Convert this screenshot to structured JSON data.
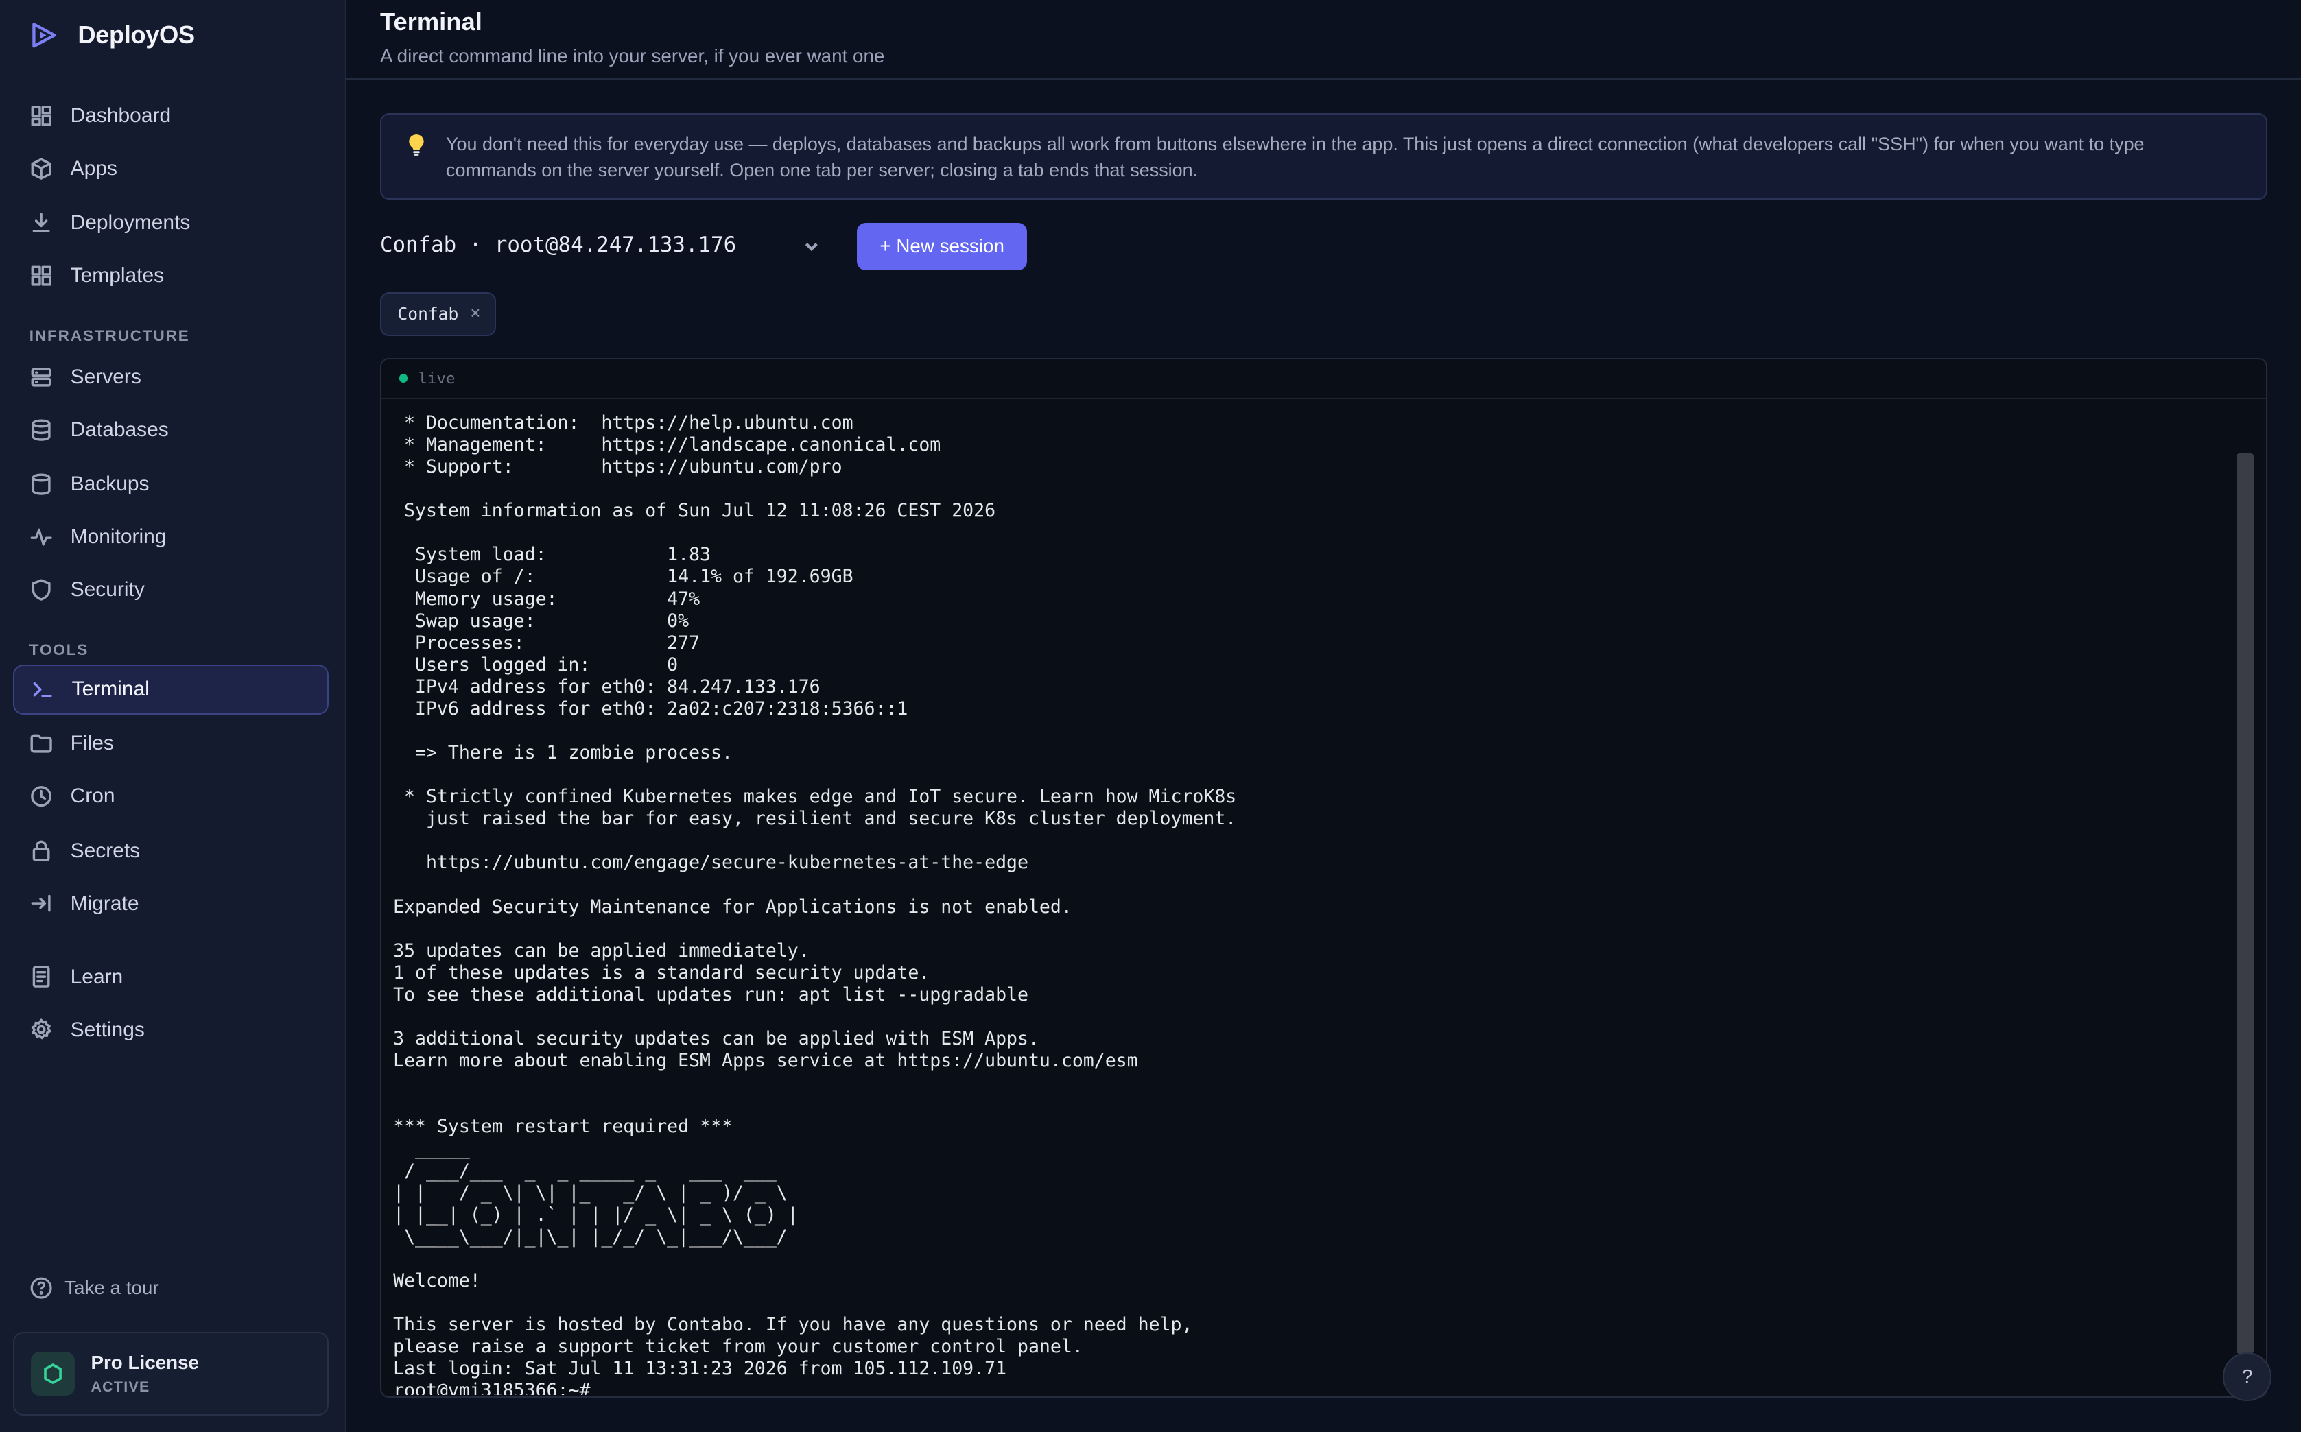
{
  "brand": {
    "name": "DeployOS",
    "logo_icon": "play-triangle-icon",
    "accent": "#6366f1"
  },
  "sidebar": {
    "main_items": [
      {
        "label": "Dashboard",
        "icon": "dashboard-icon"
      },
      {
        "label": "Apps",
        "icon": "box-icon"
      },
      {
        "label": "Deployments",
        "icon": "download-icon"
      },
      {
        "label": "Templates",
        "icon": "grid-icon"
      }
    ],
    "infrastructure_label": "INFRASTRUCTURE",
    "infrastructure_items": [
      {
        "label": "Servers",
        "icon": "server-icon"
      },
      {
        "label": "Databases",
        "icon": "database-icon"
      },
      {
        "label": "Backups",
        "icon": "database-icon"
      },
      {
        "label": "Monitoring",
        "icon": "activity-icon"
      },
      {
        "label": "Security",
        "icon": "shield-icon"
      }
    ],
    "tools_label": "TOOLS",
    "tools_items": [
      {
        "label": "Terminal",
        "icon": "terminal-icon",
        "active": true
      },
      {
        "label": "Files",
        "icon": "folder-icon"
      },
      {
        "label": "Cron",
        "icon": "clock-icon"
      },
      {
        "label": "Secrets",
        "icon": "lock-icon"
      },
      {
        "label": "Migrate",
        "icon": "arrow-right-bar-icon"
      }
    ],
    "bottom_items": [
      {
        "label": "Learn",
        "icon": "document-icon"
      },
      {
        "label": "Settings",
        "icon": "gear-icon"
      }
    ],
    "tour_label": "Take a tour",
    "license": {
      "name": "Pro License",
      "status": "ACTIVE",
      "status_color": "#34d399"
    }
  },
  "header": {
    "title": "Terminal",
    "subtitle": "A direct command line into your server, if you ever want one"
  },
  "info_banner": {
    "icon": "lightbulb-icon",
    "line1": "You don't need this for everyday use — deploys, databases and backups all work from buttons elsewhere in the app. This just opens a direct connection (what developers call \"SSH\") for when you want to type",
    "line2": "commands on the server yourself. Open one tab per server; closing a tab ends that session."
  },
  "session": {
    "selected": "Confab · root@84.247.133.176",
    "new_session_label": "+ New session"
  },
  "tabs": [
    {
      "label": "Confab",
      "close": "×"
    }
  ],
  "terminal": {
    "status": "live",
    "status_color": "#10b981",
    "lines": [
      " * Documentation:  https://help.ubuntu.com",
      " * Management:     https://landscape.canonical.com",
      " * Support:        https://ubuntu.com/pro",
      "",
      " System information as of Sun Jul 12 11:08:26 CEST 2026",
      "",
      "  System load:           1.83",
      "  Usage of /:            14.1% of 192.69GB",
      "  Memory usage:          47%",
      "  Swap usage:            0%",
      "  Processes:             277",
      "  Users logged in:       0",
      "  IPv4 address for eth0: 84.247.133.176",
      "  IPv6 address for eth0: 2a02:c207:2318:5366::1",
      "",
      "  => There is 1 zombie process.",
      "",
      " * Strictly confined Kubernetes makes edge and IoT secure. Learn how MicroK8s",
      "   just raised the bar for easy, resilient and secure K8s cluster deployment.",
      "",
      "   https://ubuntu.com/engage/secure-kubernetes-at-the-edge",
      "",
      "Expanded Security Maintenance for Applications is not enabled.",
      "",
      "35 updates can be applied immediately.",
      "1 of these updates is a standard security update.",
      "To see these additional updates run: apt list --upgradable",
      "",
      "3 additional security updates can be applied with ESM Apps.",
      "Learn more about enabling ESM Apps service at https://ubuntu.com/esm",
      "",
      "",
      "*** System restart required ***",
      "  _____",
      " / ___/___  _  _ _____ _   ___  ___",
      "| |   / _ \\| \\| |_   _/ \\ | _ )/ _ \\",
      "| |__| (_) | .` | | |/ _ \\| _ \\ (_) |",
      " \\____\\___/|_|\\_| |_/_/ \\_|___/\\___/",
      "",
      "Welcome!",
      "",
      "This server is hosted by Contabo. If you have any questions or need help,",
      "please raise a support ticket from your customer control panel.",
      "Last login: Sat Jul 11 13:31:23 2026 from 105.112.109.71",
      "root@vmi3185366:~#"
    ]
  },
  "help_button": {
    "label": "?"
  }
}
